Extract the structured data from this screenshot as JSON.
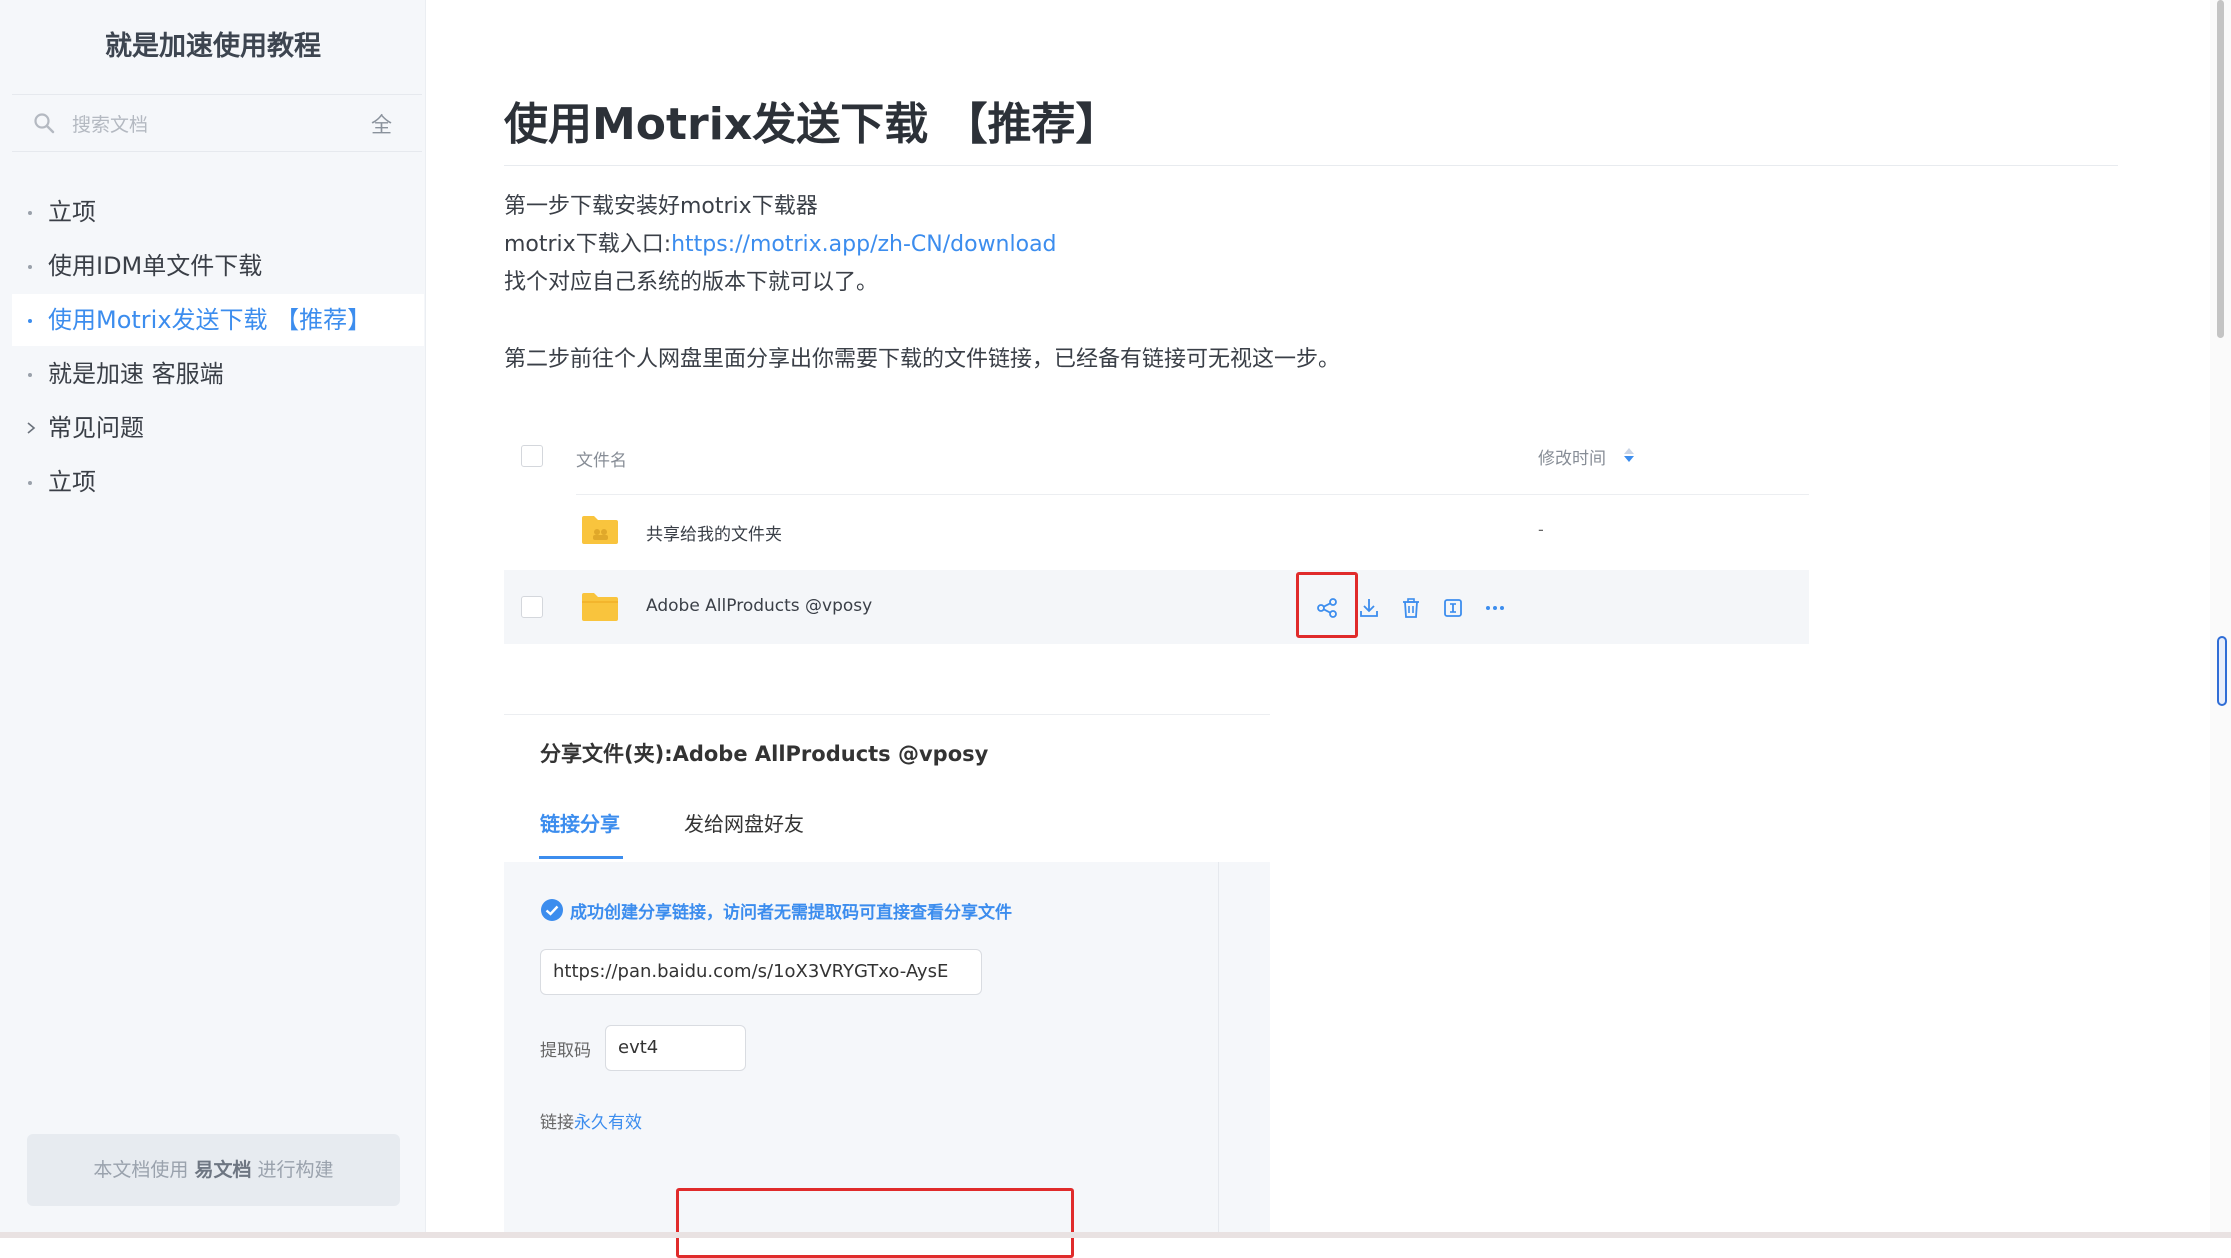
{
  "sidebar": {
    "title": "就是加速使用教程",
    "search_placeholder": "搜索文档",
    "search_scope": "全",
    "items": [
      {
        "label": "立项",
        "active": false,
        "expandable": false
      },
      {
        "label": "使用IDM单文件下载",
        "active": false,
        "expandable": false
      },
      {
        "label": "使用Motrix发送下载 【推荐】",
        "active": true,
        "expandable": false
      },
      {
        "label": "就是加速 客服端",
        "active": false,
        "expandable": false
      },
      {
        "label": "常见问题",
        "active": false,
        "expandable": true
      },
      {
        "label": "立项",
        "active": false,
        "expandable": false
      }
    ],
    "footer_prefix": "本文档使用",
    "footer_brand": "易文档",
    "footer_suffix": "进行构建"
  },
  "article": {
    "title": "使用Motrix发送下载 【推荐】",
    "step1_line1": "第一步下载安装好motrix下载器",
    "step1_link_prefix": "motrix下载入口:",
    "step1_link": "https://motrix.app/zh-CN/download",
    "step1_line3": "找个对应自己系统的版本下就可以了。",
    "step2": "第二步前往个人网盘里面分享出你需要下载的文件链接，已经备有链接可无视这一步。"
  },
  "file_list": {
    "col_name": "文件名",
    "col_time": "修改时间",
    "rows": [
      {
        "name": "共享给我的文件夹",
        "time": "-"
      },
      {
        "name": "Adobe AllProducts @vposy",
        "time": ""
      }
    ],
    "row_actions": [
      "share-icon",
      "download-icon",
      "delete-icon",
      "rename-icon",
      "more-icon"
    ]
  },
  "share_dialog": {
    "title": "分享文件(夹):Adobe AllProducts @vposy",
    "tabs": [
      "链接分享",
      "发给网盘好友"
    ],
    "success_msg": "成功创建分享链接，访问者无需提取码可直接查看分享文件",
    "link": "https://pan.baidu.com/s/1oX3VRYGTxo-AysE",
    "pwd_label": "提取码",
    "pwd": "evt4",
    "valid_prefix": "链接",
    "valid_value": "永久有效"
  },
  "colors": {
    "accent": "#3c8dee",
    "highlight": "#e02b2b",
    "folder": "#f9c43d"
  }
}
